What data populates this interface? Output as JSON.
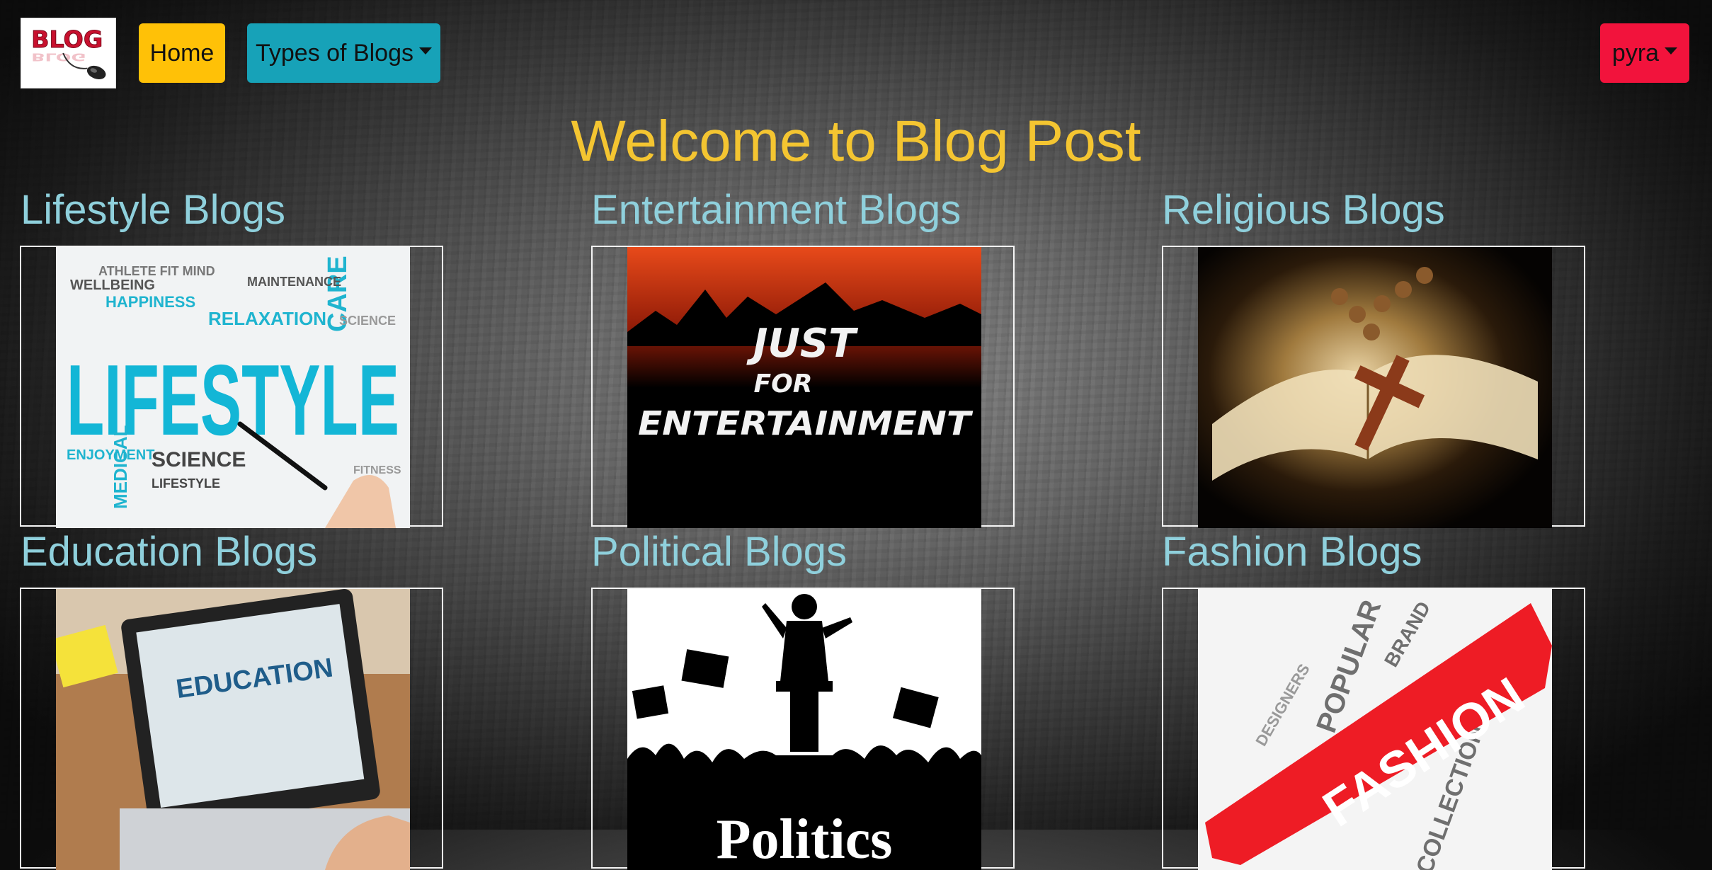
{
  "nav": {
    "logo_text": "BLOG",
    "home_label": "Home",
    "types_label": "Types of Blogs",
    "user_label": "pyra"
  },
  "page_title": "Welcome to Blog Post",
  "cards": [
    {
      "title": "Lifestyle Blogs",
      "image_text": "LIFESTYLE"
    },
    {
      "title": "Entertainment Blogs",
      "image_text": [
        "JUST",
        "FOR",
        "ENTERTAINMENT"
      ]
    },
    {
      "title": "Religious Blogs"
    },
    {
      "title": "Education Blogs",
      "image_text": "EDUCATION"
    },
    {
      "title": "Political Blogs",
      "image_text": "Politics"
    },
    {
      "title": "Fashion Blogs",
      "image_text": "FASHION"
    }
  ],
  "colors": {
    "home_button": "#ffc107",
    "types_button": "#17a2b8",
    "user_button": "#f2133c",
    "title": "#f4c531",
    "card_title": "#8fd0dc"
  },
  "icons": {
    "dropdown": "caret-down-icon"
  }
}
